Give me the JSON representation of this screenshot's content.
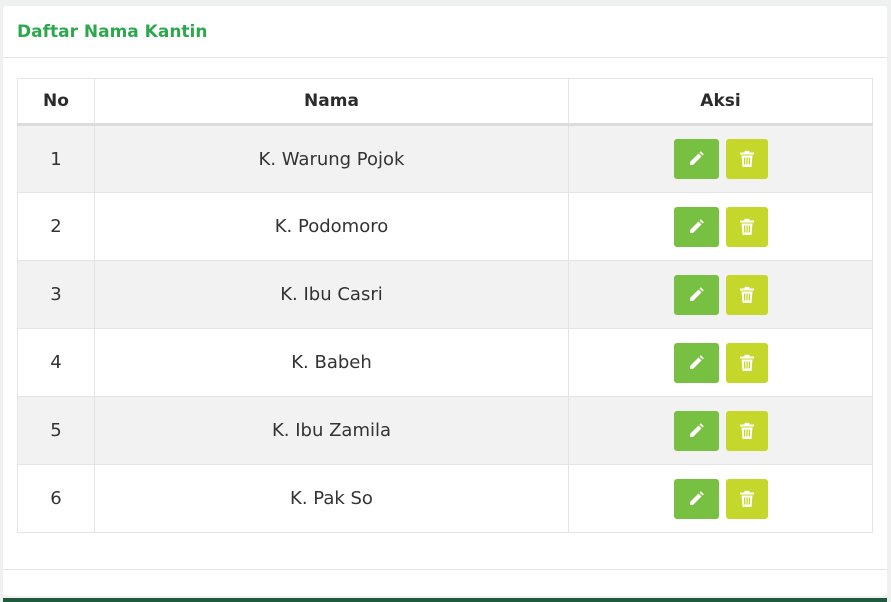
{
  "header": {
    "title": "Daftar Nama Kantin"
  },
  "table": {
    "columns": [
      "No",
      "Nama",
      "Aksi"
    ],
    "rows": [
      {
        "no": "1",
        "nama": "K. Warung Pojok"
      },
      {
        "no": "2",
        "nama": "K. Podomoro"
      },
      {
        "no": "3",
        "nama": "K. Ibu Casri"
      },
      {
        "no": "4",
        "nama": "K. Babeh"
      },
      {
        "no": "5",
        "nama": "K. Ibu Zamila"
      },
      {
        "no": "6",
        "nama": "K. Pak So"
      }
    ]
  },
  "actions": {
    "edit_icon": "pencil-icon",
    "delete_icon": "trash-icon"
  },
  "colors": {
    "title": "#2ea84f",
    "edit_button": "#77c042",
    "delete_button": "#c4d72a",
    "bottom_bar": "#1f5a3e"
  }
}
